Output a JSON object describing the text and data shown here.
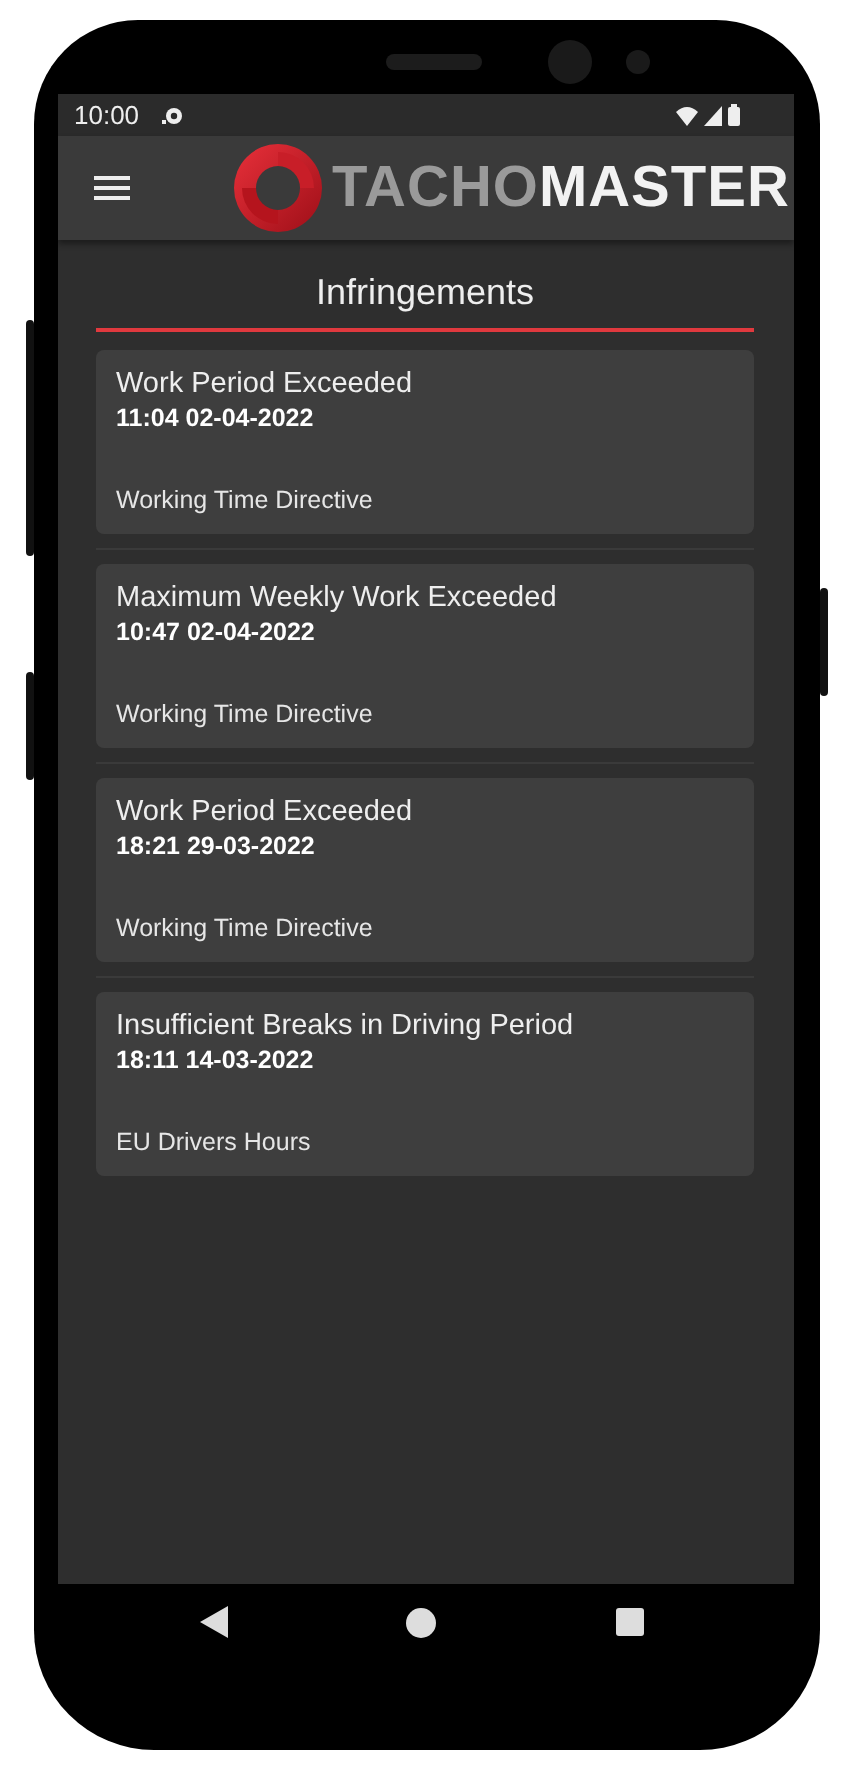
{
  "status_bar": {
    "time": "10:00"
  },
  "app_bar": {
    "logo": {
      "part_1": "TACHO",
      "part_2": "MASTER"
    }
  },
  "page": {
    "title": "Infringements"
  },
  "infringements": [
    {
      "title": "Work Period Exceeded",
      "timestamp": "11:04 02-04-2022",
      "category": "Working Time Directive"
    },
    {
      "title": "Maximum Weekly Work Exceeded",
      "timestamp": "10:47 02-04-2022",
      "category": "Working Time Directive"
    },
    {
      "title": "Work Period Exceeded",
      "timestamp": "18:21 29-03-2022",
      "category": "Working Time Directive"
    },
    {
      "title": "Insufficient Breaks in Driving Period",
      "timestamp": "18:11 14-03-2022",
      "category": "EU Drivers Hours"
    }
  ]
}
